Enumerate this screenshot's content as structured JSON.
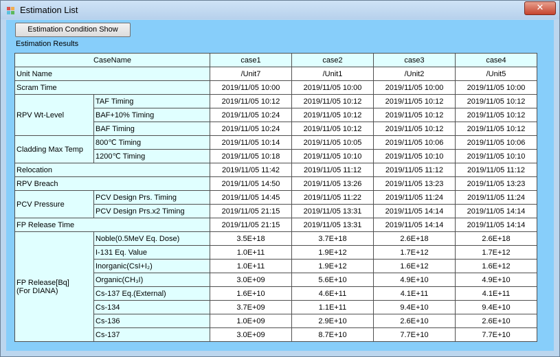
{
  "window": {
    "title": "Estimation List",
    "close_glyph": "✕"
  },
  "toolbar": {
    "show_button_label": "Estimation Condition Show"
  },
  "results_label": "Estimation Results",
  "table": {
    "corner": "CaseName",
    "cases": [
      "case1",
      "case2",
      "case3",
      "case4"
    ],
    "unit_name": {
      "label": "Unit Name",
      "values": [
        "/Unit7",
        "/Unit1",
        "/Unit2",
        "/Unit5"
      ]
    },
    "scram_time": {
      "label": "Scram Time",
      "values": [
        "2019/11/05 10:00",
        "2019/11/05 10:00",
        "2019/11/05 10:00",
        "2019/11/05 10:00"
      ]
    },
    "rpv_wt_level": {
      "label": "RPV Wt-Level",
      "rows": [
        {
          "label": "TAF Timing",
          "values": [
            "2019/11/05 10:12",
            "2019/11/05 10:12",
            "2019/11/05 10:12",
            "2019/11/05 10:12"
          ]
        },
        {
          "label": "BAF+10% Timing",
          "values": [
            "2019/11/05 10:24",
            "2019/11/05 10:12",
            "2019/11/05 10:12",
            "2019/11/05 10:12"
          ]
        },
        {
          "label": "BAF Timing",
          "values": [
            "2019/11/05 10:24",
            "2019/11/05 10:12",
            "2019/11/05 10:12",
            "2019/11/05 10:12"
          ]
        }
      ]
    },
    "cladding_max_temp": {
      "label": "Cladding Max Temp",
      "rows": [
        {
          "label": "800℃ Timing",
          "values": [
            "2019/11/05 10:14",
            "2019/11/05 10:05",
            "2019/11/05 10:06",
            "2019/11/05 10:06"
          ]
        },
        {
          "label": "1200℃ Timing",
          "values": [
            "2019/11/05 10:18",
            "2019/11/05 10:10",
            "2019/11/05 10:10",
            "2019/11/05 10:10"
          ]
        }
      ]
    },
    "relocation": {
      "label": "Relocation",
      "values": [
        "2019/11/05 11:42",
        "2019/11/05 11:12",
        "2019/11/05 11:12",
        "2019/11/05 11:12"
      ]
    },
    "rpv_breach": {
      "label": "RPV Breach",
      "values": [
        "2019/11/05 14:50",
        "2019/11/05 13:26",
        "2019/11/05 13:23",
        "2019/11/05 13:23"
      ]
    },
    "pcv_pressure": {
      "label": "PCV Pressure",
      "rows": [
        {
          "label": "PCV Design Prs. Timing",
          "values": [
            "2019/11/05 14:45",
            "2019/11/05 11:22",
            "2019/11/05 11:24",
            "2019/11/05 11:24"
          ]
        },
        {
          "label": "PCV Design Prs.x2 Timing",
          "values": [
            "2019/11/05 21:15",
            "2019/11/05 13:31",
            "2019/11/05 14:14",
            "2019/11/05 14:14"
          ]
        }
      ]
    },
    "fp_release_time": {
      "label": "FP Release Time",
      "values": [
        "2019/11/05 21:15",
        "2019/11/05 13:31",
        "2019/11/05 14:14",
        "2019/11/05 14:14"
      ]
    },
    "fp_release": {
      "label_line1": "FP Release[Bq]",
      "label_line2": "(For DIANA)",
      "rows": [
        {
          "label": "Noble(0.5MeV Eq. Dose)",
          "values": [
            "3.5E+18",
            "3.7E+18",
            "2.6E+18",
            "2.6E+18"
          ]
        },
        {
          "label": "I-131 Eq. Value",
          "values": [
            "1.0E+11",
            "1.9E+12",
            "1.7E+12",
            "1.7E+12"
          ]
        },
        {
          "label": "Inorganic(CsI+I₂)",
          "values": [
            "1.0E+11",
            "1.9E+12",
            "1.6E+12",
            "1.6E+12"
          ]
        },
        {
          "label": "Organic(CH₃I)",
          "values": [
            "3.0E+09",
            "5.6E+10",
            "4.9E+10",
            "4.9E+10"
          ]
        },
        {
          "label": "Cs-137 Eq.(External)",
          "values": [
            "1.6E+10",
            "4.6E+11",
            "4.1E+11",
            "4.1E+11"
          ]
        },
        {
          "label": "Cs-134",
          "values": [
            "3.7E+09",
            "1.1E+11",
            "9.4E+10",
            "9.4E+10"
          ]
        },
        {
          "label": "Cs-136",
          "values": [
            "1.0E+09",
            "2.9E+10",
            "2.6E+10",
            "2.6E+10"
          ]
        },
        {
          "label": "Cs-137",
          "values": [
            "3.0E+09",
            "8.7E+10",
            "7.7E+10",
            "7.7E+10"
          ]
        }
      ]
    }
  }
}
